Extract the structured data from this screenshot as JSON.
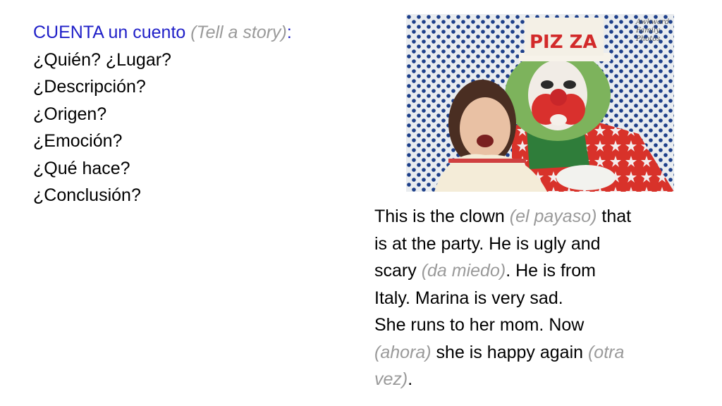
{
  "prompt": {
    "title_bold": "CUENTA un cuento",
    "title_sub": "(Tell a story)",
    "title_colon": ":",
    "questions": [
      "¿Quién? ¿Lugar?",
      "¿Descripción?",
      "¿Origen?",
      "¿Emoción?",
      "¿Qué hace?",
      "¿Conclusión?"
    ]
  },
  "photo": {
    "hat_text": "PIZ ZA",
    "watermark": [
      "Awkward",
      "Family",
      "Photos"
    ]
  },
  "story": {
    "l1": [
      "This is the clown ",
      "(el payaso)",
      " that"
    ],
    "l2": "is at the party. He is ugly and",
    "l3": [
      "scary ",
      "(da miedo)",
      ". He is from"
    ],
    "l4": "Italy. Marina is very sad.",
    "l5": "She runs to her mom.  Now",
    "l6": [
      "(ahora)",
      " she is happy again ",
      "(otra"
    ],
    "l7": [
      "vez)",
      "."
    ]
  },
  "colors": {
    "title": "#1f1fc8",
    "translation": "#9a9a9a"
  }
}
